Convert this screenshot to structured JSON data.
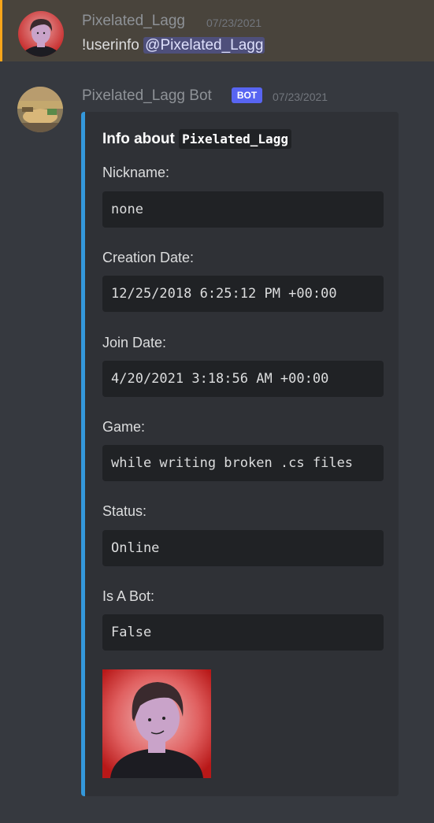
{
  "messages": [
    {
      "username": "Pixelated_Lagg",
      "timestamp": "07/23/2021",
      "command": "!userinfo",
      "mention": "@Pixelated_Lagg"
    },
    {
      "username": "Pixelated_Lagg Bot",
      "bot_tag": "BOT",
      "timestamp": "07/23/2021",
      "embed": {
        "title_prefix": "Info about",
        "title_code": "Pixelated_Lagg",
        "accent_color": "#3498db",
        "fields": [
          {
            "name": "Nickname:",
            "value": "none"
          },
          {
            "name": "Creation Date:",
            "value": "12/25/2018 6:25:12 PM +00:00"
          },
          {
            "name": "Join Date:",
            "value": "4/20/2021 3:18:56 AM +00:00"
          },
          {
            "name": "Game:",
            "value": "while writing broken .cs files"
          },
          {
            "name": "Status:",
            "value": "Online"
          },
          {
            "name": "Is A Bot:",
            "value": "False"
          }
        ]
      }
    }
  ],
  "colors": {
    "background": "#36393f",
    "highlight_background": "#49443c",
    "highlight_border": "#faa61a",
    "embed_background": "#2f3136",
    "bot_tag": "#5865f2"
  }
}
